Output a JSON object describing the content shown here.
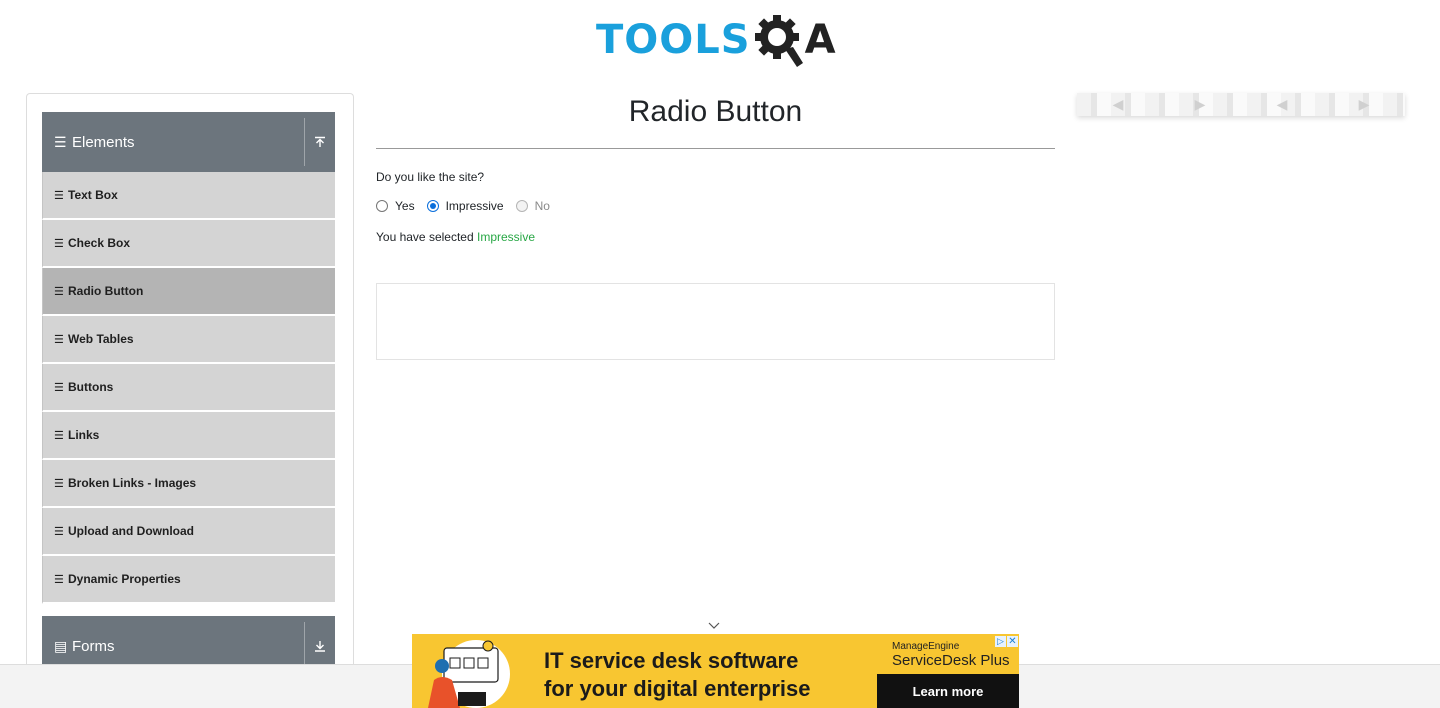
{
  "header": {
    "logo_primary": "TOOLS",
    "logo_secondary": "A",
    "logo_icon": "gear-magnifier-icon"
  },
  "sidebar": {
    "groups": [
      {
        "label": "Elements",
        "icon": "hamburger-icon",
        "toggle_icon": "collapse-up-icon"
      },
      {
        "label": "Forms",
        "icon": "list-icon",
        "toggle_icon": "expand-down-icon"
      }
    ],
    "items": [
      {
        "label": "Text Box"
      },
      {
        "label": "Check Box"
      },
      {
        "label": "Radio Button",
        "active": true
      },
      {
        "label": "Web Tables"
      },
      {
        "label": "Buttons"
      },
      {
        "label": "Links"
      },
      {
        "label": "Broken Links - Images"
      },
      {
        "label": "Upload and Download"
      },
      {
        "label": "Dynamic Properties"
      }
    ]
  },
  "main": {
    "title": "Radio Button",
    "question": "Do you like the site?",
    "options": [
      {
        "label": "Yes",
        "checked": false,
        "disabled": false
      },
      {
        "label": "Impressive",
        "checked": true,
        "disabled": false
      },
      {
        "label": "No",
        "checked": false,
        "disabled": true
      }
    ],
    "result_prefix": "You have selected",
    "result_value": "Impressive"
  },
  "ad": {
    "headline_line1": "IT service desk software",
    "headline_line2": "for your digital enterprise",
    "brand_top": "ManageEngine",
    "brand_main": "ServiceDesk Plus",
    "cta": "Learn more"
  },
  "colors": {
    "brand_blue": "#1aa0dc",
    "sidebar_header": "#6c757d",
    "menu_item_bg": "#d4d4d4",
    "menu_item_active": "#b4b4b4",
    "success_text": "#28a745",
    "radio_checked": "#0b6fdc",
    "ad_yellow": "#f8c631"
  }
}
